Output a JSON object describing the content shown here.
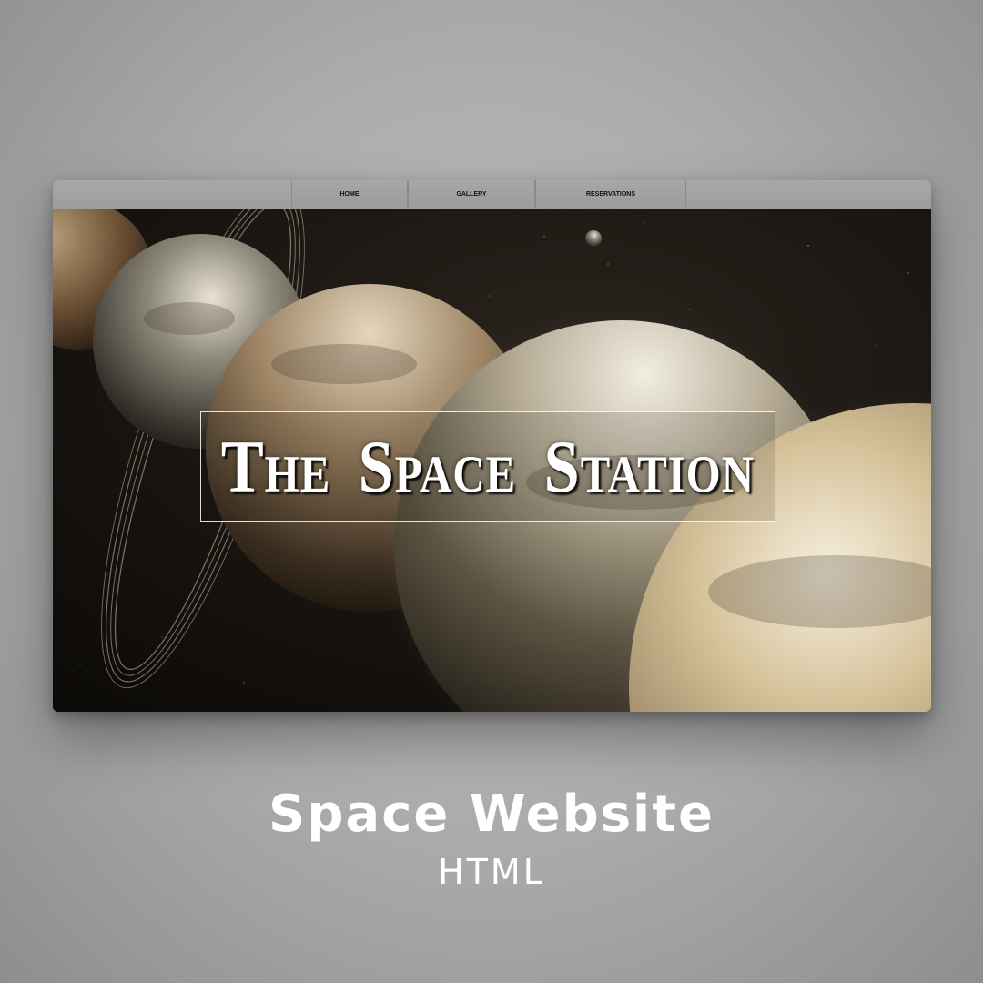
{
  "nav": {
    "items": [
      {
        "label": "HOME"
      },
      {
        "label": "GALLERY"
      },
      {
        "label": "RESERVATIONS"
      }
    ]
  },
  "hero": {
    "title": "The Space Station",
    "background": "planets-in-space-image"
  },
  "caption": {
    "title": "Space Website",
    "subtitle": "HTML"
  },
  "colors": {
    "page_background": "#a9a9a9",
    "nav_background": "#a3a3a3",
    "title_color": "#ffffff",
    "caption_color": "#ffffff"
  }
}
